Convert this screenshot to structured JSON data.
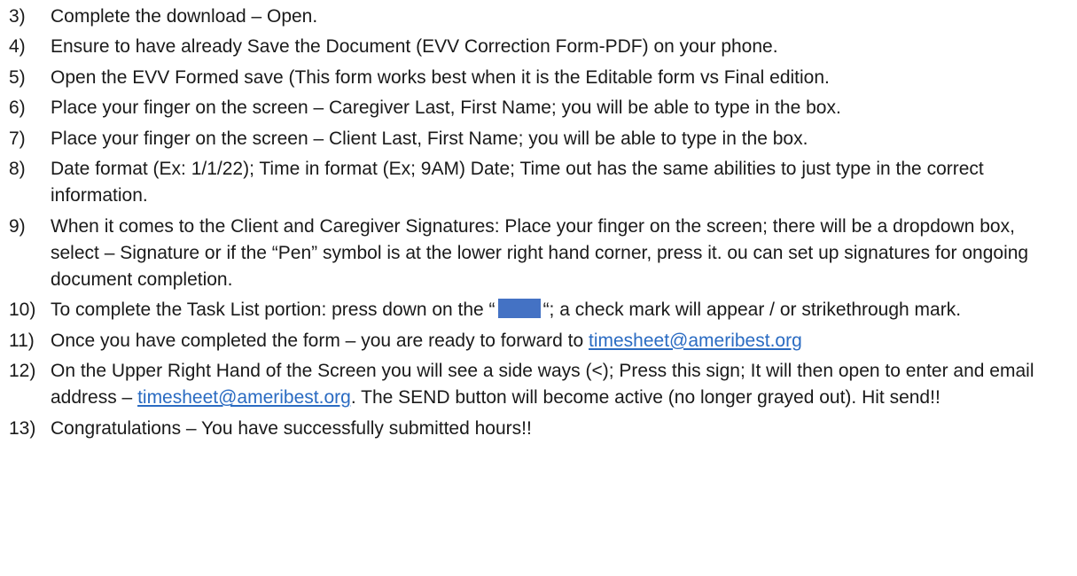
{
  "steps": [
    {
      "number": "3)",
      "text": "Complete the download – Open."
    },
    {
      "number": "4)",
      "text": "Ensure to have already Save the Document (EVV Correction Form-PDF) on your phone."
    },
    {
      "number": "5)",
      "text": "Open the EVV Formed save (This form works best when it is the Editable form vs Final edition."
    },
    {
      "number": "6)",
      "text": "Place your finger on the screen – Caregiver Last, First Name; you will be able to type in the box."
    },
    {
      "number": "7)",
      "text": "Place your finger on the screen – Client Last, First Name; you will be able to type in the box."
    },
    {
      "number": "8)",
      "text": "Date format (Ex: 1/1/22); Time in format (Ex; 9AM) Date; Time out has the same abilities to just type in the correct information."
    },
    {
      "number": "9)",
      "text": "When it comes to the Client and Caregiver Signatures: Place your finger on the screen; there will be a dropdown box, select – Signature or if the “Pen” symbol is at the lower right hand corner, press it. ou can set up signatures for ongoing document completion."
    },
    {
      "number": "10)",
      "text_before": "To complete the Task List portion: press down on the “",
      "text_after": "“; a check mark will appear / or strikethrough mark.",
      "swatch_color": "#4472c4"
    },
    {
      "number": "11)",
      "text_before": "Once you have completed the form – you are ready to forward to ",
      "link": "timesheet@ameribest.org"
    },
    {
      "number": "12)",
      "text_before": "On the Upper Right Hand of the Screen you will see a side ways (<); Press this sign; It will then open to enter and email address – ",
      "link": "timesheet@ameribest.org",
      "text_after": ". The SEND button will become active (no longer grayed out). Hit send!!"
    },
    {
      "number": "13)",
      "text": "Congratulations – You have successfully submitted hours!!"
    }
  ],
  "colors": {
    "text": "#1a1a1a",
    "link": "#2a6bc2",
    "swatch": "#4472c4"
  }
}
